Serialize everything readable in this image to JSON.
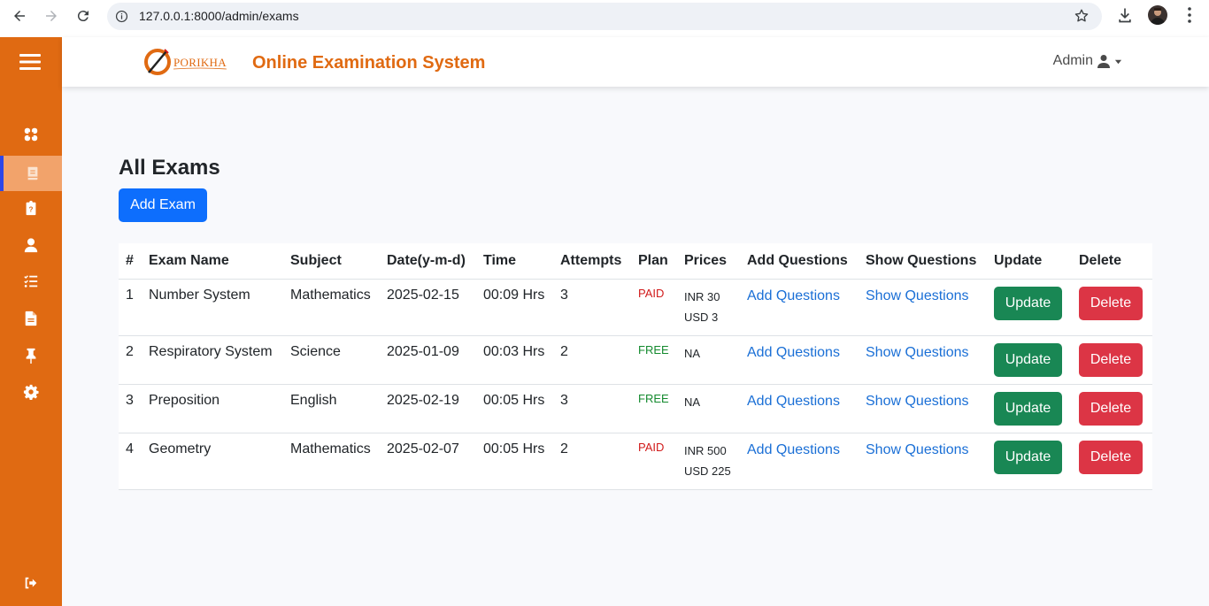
{
  "browser": {
    "url": "127.0.0.1:8000/admin/exams"
  },
  "header": {
    "logo_text": "PORIKHA",
    "app_title": "Online Examination System",
    "admin_label": "Admin"
  },
  "sidebar": {
    "items": [
      {
        "icon": "dashboard-icon"
      },
      {
        "icon": "book-icon",
        "active": true
      },
      {
        "icon": "clipboard-question-icon"
      },
      {
        "icon": "user-icon"
      },
      {
        "icon": "list-check-icon"
      },
      {
        "icon": "file-icon"
      },
      {
        "icon": "thumbtack-icon"
      },
      {
        "icon": "gear-icon"
      }
    ],
    "logout_icon": "logout-icon"
  },
  "main": {
    "title": "All Exams",
    "add_exam_label": "Add Exam",
    "columns": [
      "#",
      "Exam Name",
      "Subject",
      "Date(y-m-d)",
      "Time",
      "Attempts",
      "Plan",
      "Prices",
      "Add Questions",
      "Show Questions",
      "Update",
      "Delete"
    ],
    "rows": [
      {
        "num": "1",
        "name": "Number System",
        "subject": "Mathematics",
        "date": "2025-02-15",
        "time": "00:09 Hrs",
        "attempts": "3",
        "plan": "PAID",
        "price1": "INR 30",
        "price2": "USD 3",
        "add_q": "Add Questions",
        "show_q": "Show Questions",
        "update": "Update",
        "delete": "Delete"
      },
      {
        "num": "2",
        "name": "Respiratory System",
        "subject": "Science",
        "date": "2025-01-09",
        "time": "00:03 Hrs",
        "attempts": "2",
        "plan": "FREE",
        "price1": "NA",
        "price2": "",
        "add_q": "Add Questions",
        "show_q": "Show Questions",
        "update": "Update",
        "delete": "Delete"
      },
      {
        "num": "3",
        "name": "Preposition",
        "subject": "English",
        "date": "2025-02-19",
        "time": "00:05 Hrs",
        "attempts": "3",
        "plan": "FREE",
        "price1": "NA",
        "price2": "",
        "add_q": "Add Questions",
        "show_q": "Show Questions",
        "update": "Update",
        "delete": "Delete"
      },
      {
        "num": "4",
        "name": "Geometry",
        "subject": "Mathematics",
        "date": "2025-02-07",
        "time": "00:05 Hrs",
        "attempts": "2",
        "plan": "PAID",
        "price1": "INR 500",
        "price2": "USD 225",
        "add_q": "Add Questions",
        "show_q": "Show Questions",
        "update": "Update",
        "delete": "Delete"
      }
    ]
  },
  "colors": {
    "brand_orange": "#e06a12",
    "primary": "#0d6efd",
    "success": "#198754",
    "danger": "#dc3545"
  }
}
